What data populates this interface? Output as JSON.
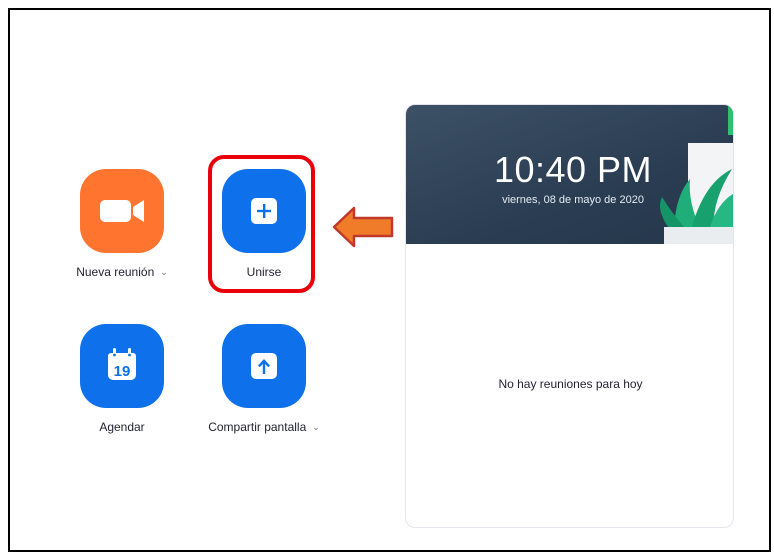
{
  "actions": {
    "new_meeting": {
      "label": "Nueva reunión",
      "icon": "video-camera-icon",
      "color": "#ff742e"
    },
    "join": {
      "label": "Unirse",
      "icon": "plus-icon",
      "color": "#0e71eb"
    },
    "schedule": {
      "label": "Agendar",
      "icon": "calendar-icon",
      "calendar_day": "19",
      "color": "#0e71eb"
    },
    "share_screen": {
      "label": "Compartir pantalla",
      "icon": "upload-arrow-icon",
      "color": "#0e71eb"
    }
  },
  "annotation": {
    "highlight_color": "#e8000b",
    "arrow_color": "#f07c2a",
    "arrow_icon": "left-arrow-icon"
  },
  "calendar_panel": {
    "time": "10:40 PM",
    "date": "viernes, 08 de mayo de 2020",
    "empty_message": "No hay reuniones para hoy"
  }
}
